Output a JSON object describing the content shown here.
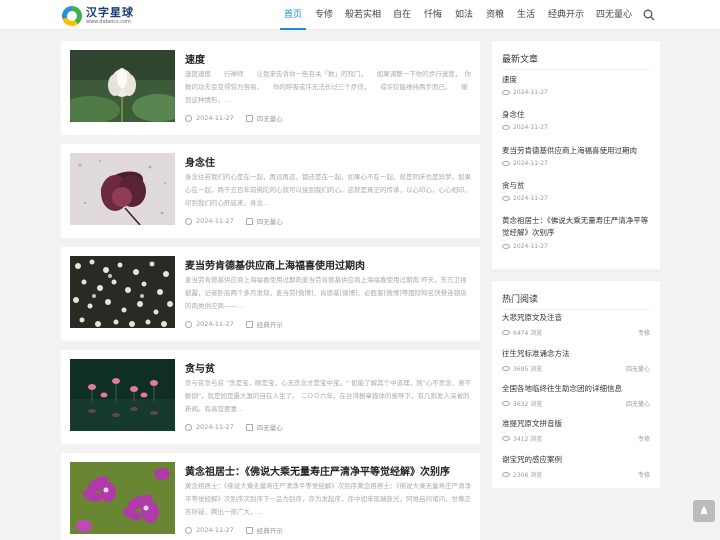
{
  "header": {
    "logo_title": "汉字星球",
    "logo_url": "www.dabeics.com",
    "nav": [
      {
        "label": "首页",
        "active": true
      },
      {
        "label": "专修",
        "active": false
      },
      {
        "label": "般若实相",
        "active": false
      },
      {
        "label": "自在",
        "active": false
      },
      {
        "label": "忏悔",
        "active": false
      },
      {
        "label": "如法",
        "active": false
      },
      {
        "label": "资粮",
        "active": false
      },
      {
        "label": "生活",
        "active": false
      },
      {
        "label": "经典开示",
        "active": false
      },
      {
        "label": "四无量心",
        "active": false
      }
    ],
    "search_icon": "search-icon",
    "accent": "#1e88e5"
  },
  "posts": [
    {
      "title": "速度",
      "excerpt": "速度速度　　行禅师　　让我来告诉你一些有关「数」的窍门。　　如果调整一下你的步行速度，　你数的功夫会变得较为容易。　　你的呼吸或许无法长过三个步伐，　　或许仅能维持两步而已。　　碰到这种情形，...",
      "date": "2024-11-27",
      "category": "四无量心"
    },
    {
      "title": "身念住",
      "excerpt": "身念住若我们的心是在一起，再远再远，都还是在一起，如果心不在一起，就是同床也是异梦。如果心在一起，两千五百年前佛陀的心就可以接到我们的心，这就是真正的传承，以心印心，心心相印。印到我们的心肝底来，身念...",
      "date": "2024-11-27",
      "category": "四无量心"
    },
    {
      "title": "麦当劳肯德基供应商上海福喜使用过期肉",
      "excerpt": "麦当劳肯德基供应商上海福喜使用过期肉麦当劳肯德基供应商上海福喜使用过期肉 昨天，东方卫视披露，记者卧底两个多月发现，麦当劳[微博]、肯德基[微博]、必胜客[微博]等国际知名快餐连锁店的肉类供应商——...",
      "date": "2024-11-27",
      "category": "经典开示"
    },
    {
      "title": "贪与贫",
      "excerpt": "贪与贫贪与贫 \"贪是宝，眼是宝，心无贪念才是宝中宝。\" 如能了解其个中道理，则\"心不贪念，意不颠倒\"，就是如是最大富的自在人生了。 二ＯＯ六年，在台湾报章媒体的报导下，有几则发人深省的新闻。有高官要妻...",
      "date": "2024-11-27",
      "category": "四无量心"
    },
    {
      "title": "黄念祖居士：《佛说大乘无量寿庄严清净平等觉经解》次别序",
      "excerpt": "黄念祖居士：《佛说大乘无量寿庄严清净平等觉经解》次别序黄念祖居士：《佛说大乘无量寿庄严清净平等觉经解》次别序次别序下一品为别序，亦为发起序，序中如来现瑞放光，阿难启问诸问，世尊正答所疑，腾出一部广大，...",
      "date": "2024-11-27",
      "category": "经典开示"
    }
  ],
  "sidebar": {
    "latest_title": "最新文章",
    "latest": [
      {
        "title": "速度",
        "date": "2024-11-27"
      },
      {
        "title": "身念住",
        "date": "2024-11-27"
      },
      {
        "title": "麦当劳肯德基供应商上海福喜使用过期肉",
        "date": "2024-11-27"
      },
      {
        "title": "贪与贫",
        "date": "2024-11-27"
      },
      {
        "title": "黄念祖居士：《佛说大乘无量寿庄严清净平等觉经解》次别序",
        "date": "2024-11-27"
      }
    ],
    "popular_title": "热门阅读",
    "popular": [
      {
        "title": "大悲咒原文及注音",
        "views": "6474 浏览",
        "category": "专修"
      },
      {
        "title": "往生咒标准诵念方法",
        "views": "3695 浏览",
        "category": "四无量心"
      },
      {
        "title": "全国各地临终往生助念团的详细信息",
        "views": "3632 浏览",
        "category": "四无量心"
      },
      {
        "title": "准提咒原文拼音版",
        "views": "3412 浏览",
        "category": "专修"
      },
      {
        "title": "谢宝咒的感应案例",
        "views": "2306 浏览",
        "category": "专修"
      }
    ]
  }
}
